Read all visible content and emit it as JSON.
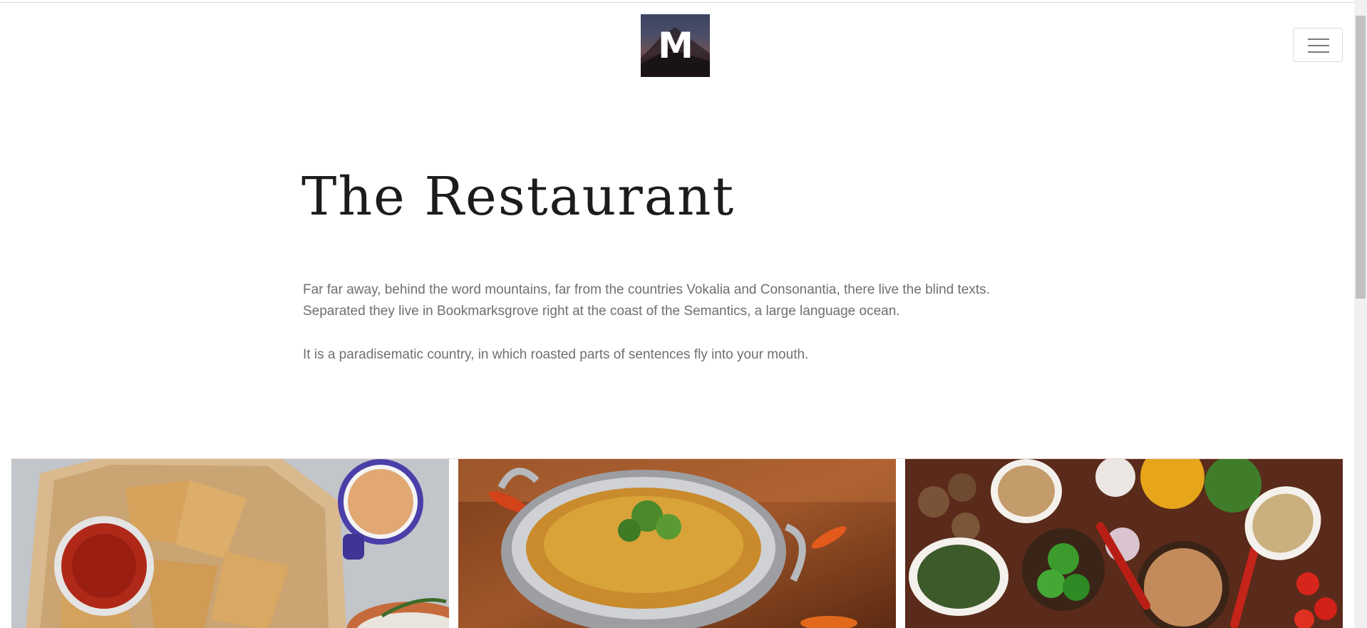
{
  "header": {
    "logo_letter": "M",
    "menu_button_icon": "hamburger-icon"
  },
  "hero": {
    "title": "The Restaurant",
    "paragraph_1": "Far far away, behind the word mountains, far from the countries Vokalia and Consonantia, there live the blind texts. Separated they live in Bookmarksgrove right at the coast of the Semantics, a large language ocean.",
    "paragraph_2": "It is a paradisematic country, in which roasted parts of sentences fly into your mouth."
  },
  "gallery": {
    "images": [
      {
        "icon": "samosa-photo"
      },
      {
        "icon": "curry-photo"
      },
      {
        "icon": "spices-photo"
      }
    ]
  },
  "colors": {
    "title": "#1c1c1c",
    "body_text": "#6f6f6f",
    "background": "#ffffff"
  }
}
